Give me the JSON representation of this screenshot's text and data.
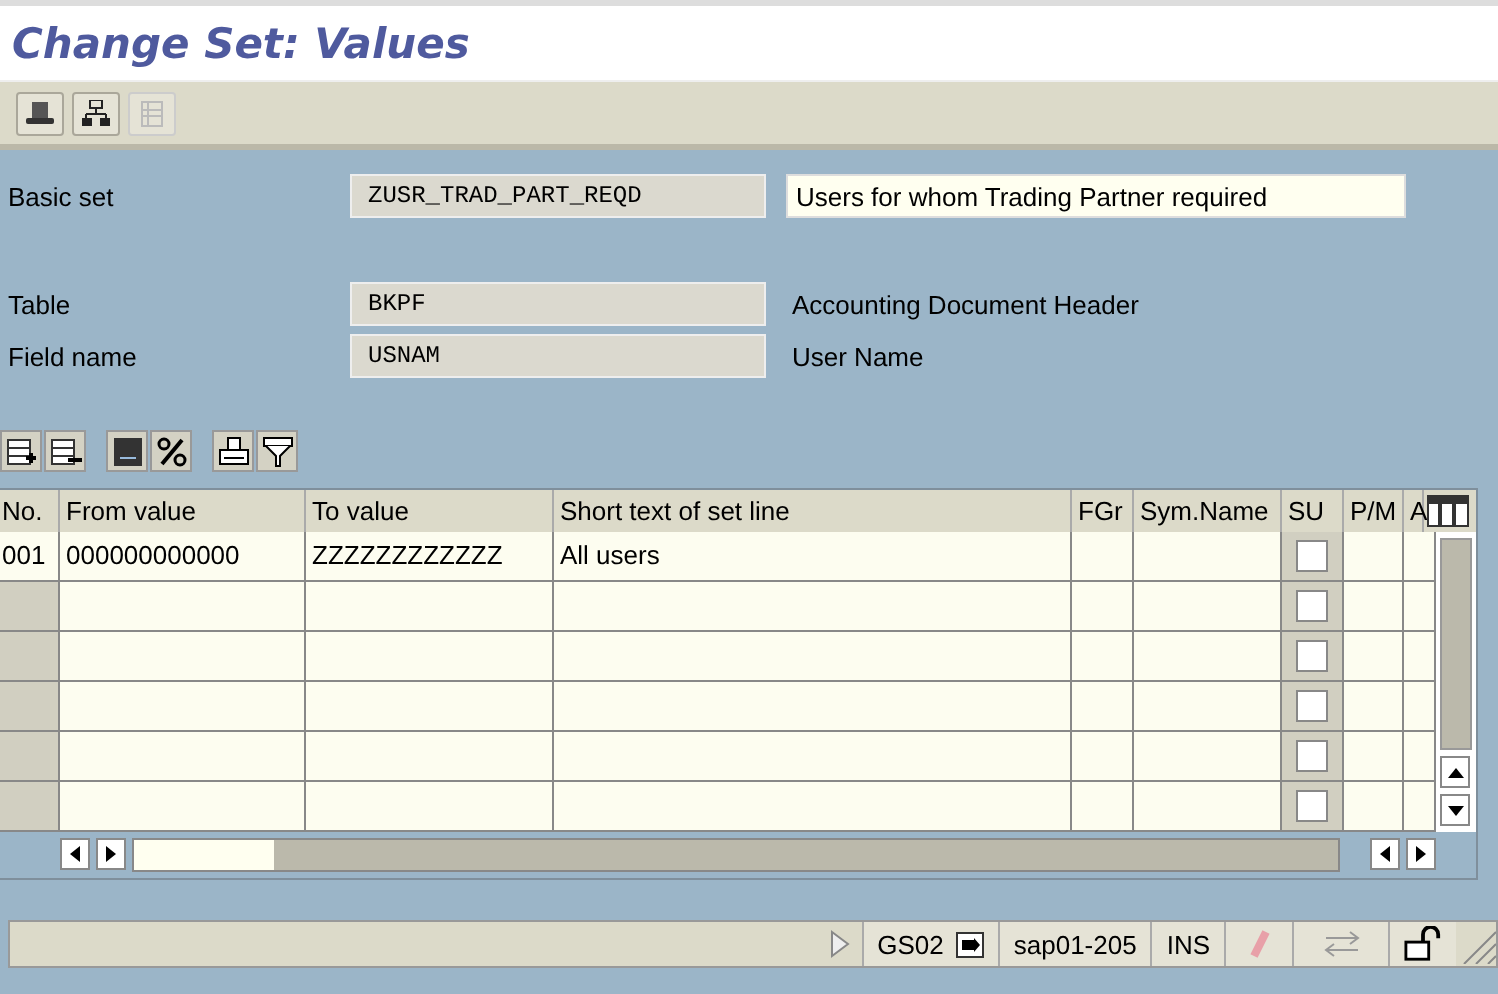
{
  "window": {
    "title": "Change Set: Values"
  },
  "fields": [
    {
      "label": "Basic set",
      "value": "ZUSR_TRAD_PART_REQD",
      "description": "Users for whom Trading Partner required",
      "kind": "editable"
    },
    {
      "label": "Table",
      "value": "BKPF",
      "description": "Accounting Document Header",
      "kind": "display"
    },
    {
      "label": "Field name",
      "value": "USNAM",
      "description": "User Name",
      "kind": "display"
    }
  ],
  "table": {
    "columns": [
      "No.",
      "From value",
      "To value",
      "Short text of set line",
      "FGr",
      "Sym.Name",
      "SU",
      "P/M",
      "A"
    ],
    "rows": [
      {
        "no": "001",
        "from": "000000000000",
        "to": "ZZZZZZZZZZZZ",
        "short_text": "All users",
        "su_checked": false
      },
      {
        "no": "",
        "from": "",
        "to": "",
        "short_text": "",
        "su_checked": false
      },
      {
        "no": "",
        "from": "",
        "to": "",
        "short_text": "",
        "su_checked": false
      },
      {
        "no": "",
        "from": "",
        "to": "",
        "short_text": "",
        "su_checked": false
      },
      {
        "no": "",
        "from": "",
        "to": "",
        "short_text": "",
        "su_checked": false
      },
      {
        "no": "",
        "from": "",
        "to": "",
        "short_text": "",
        "su_checked": false
      }
    ]
  },
  "status_bar": {
    "transaction": "GS02",
    "server": "sap01-205",
    "mode": "INS"
  }
}
